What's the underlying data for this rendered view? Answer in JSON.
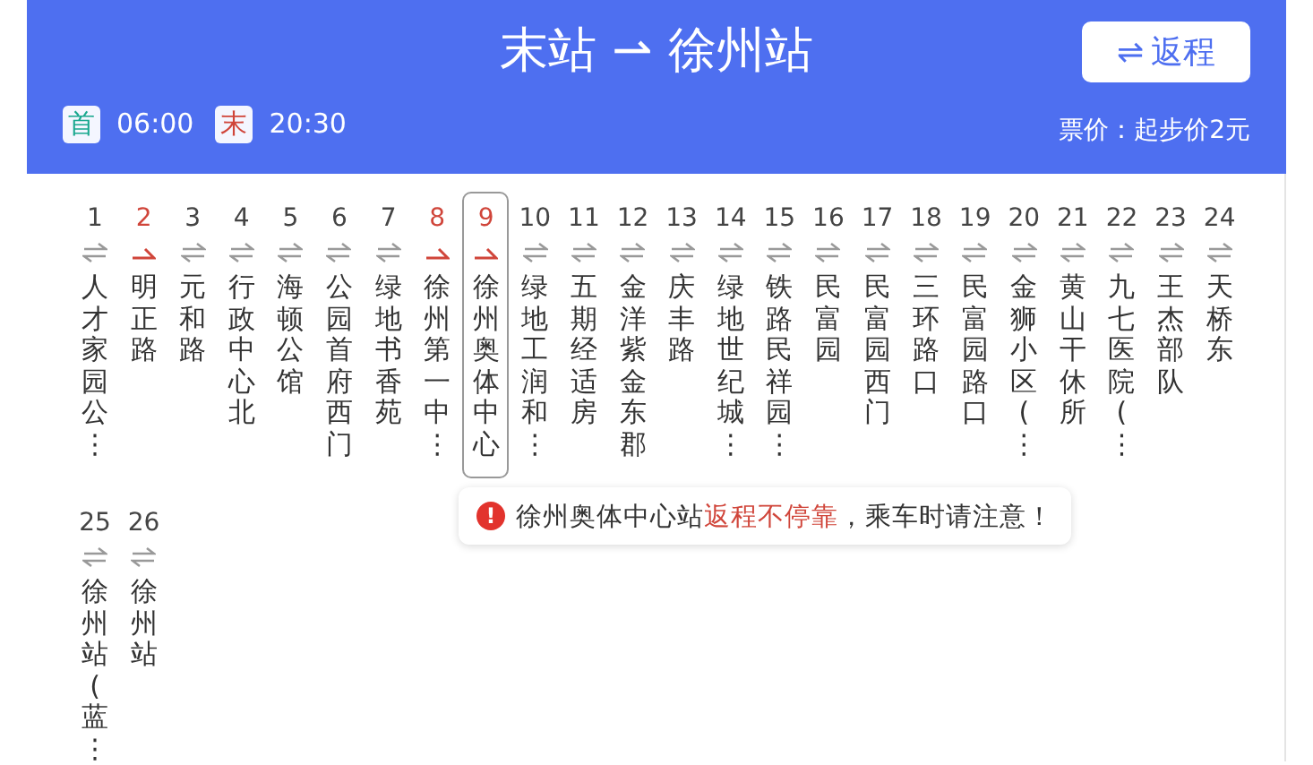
{
  "header": {
    "title": "末站 ⇀ 徐州站",
    "return_button": {
      "icon": "⇌",
      "label": "返程"
    },
    "first_bus": {
      "badge": "首",
      "time": "06:00"
    },
    "last_bus": {
      "badge": "末",
      "time": "20:30"
    },
    "fare": "票价：起步价2元"
  },
  "stops": [
    {
      "number": "1",
      "name": "人才家园公⋮",
      "kind": "both",
      "selected": false
    },
    {
      "number": "2",
      "name": "明正路",
      "kind": "one-way",
      "selected": false
    },
    {
      "number": "3",
      "name": "元和路",
      "kind": "both",
      "selected": false
    },
    {
      "number": "4",
      "name": "行政中心北",
      "kind": "both",
      "selected": false
    },
    {
      "number": "5",
      "name": "海顿公馆",
      "kind": "both",
      "selected": false
    },
    {
      "number": "6",
      "name": "公园首府西门",
      "kind": "both",
      "selected": false
    },
    {
      "number": "7",
      "name": "绿地书香苑",
      "kind": "both",
      "selected": false
    },
    {
      "number": "8",
      "name": "徐州第一中⋮",
      "kind": "one-way",
      "selected": false
    },
    {
      "number": "9",
      "name": "徐州奥体中心",
      "kind": "one-way",
      "selected": true
    },
    {
      "number": "10",
      "name": "绿地工润和⋮",
      "kind": "both",
      "selected": false
    },
    {
      "number": "11",
      "name": "五期经适房",
      "kind": "both",
      "selected": false
    },
    {
      "number": "12",
      "name": "金洋紫金东郡",
      "kind": "both",
      "selected": false
    },
    {
      "number": "13",
      "name": "庆丰路",
      "kind": "both",
      "selected": false
    },
    {
      "number": "14",
      "name": "绿地世纪城⋮",
      "kind": "both",
      "selected": false
    },
    {
      "number": "15",
      "name": "铁路民祥园⋮",
      "kind": "both",
      "selected": false
    },
    {
      "number": "16",
      "name": "民富园",
      "kind": "both",
      "selected": false
    },
    {
      "number": "17",
      "name": "民富园西门",
      "kind": "both",
      "selected": false
    },
    {
      "number": "18",
      "name": "三环路口",
      "kind": "both",
      "selected": false
    },
    {
      "number": "19",
      "name": "民富园路口",
      "kind": "both",
      "selected": false
    },
    {
      "number": "20",
      "name": "金狮小区(⋮",
      "kind": "both",
      "selected": false
    },
    {
      "number": "21",
      "name": "黄山干休所",
      "kind": "both",
      "selected": false
    },
    {
      "number": "22",
      "name": "九七医院(⋮",
      "kind": "both",
      "selected": false
    },
    {
      "number": "23",
      "name": "王杰部队",
      "kind": "both",
      "selected": false
    },
    {
      "number": "24",
      "name": "天桥东",
      "kind": "both",
      "selected": false
    },
    {
      "number": "25",
      "name": "徐州站(蓝⋮",
      "kind": "both",
      "selected": false
    },
    {
      "number": "26",
      "name": "徐州站",
      "kind": "both",
      "selected": false
    }
  ],
  "notice": {
    "icon": "!",
    "parts": [
      {
        "text": "徐州奥体中心站",
        "highlight": false
      },
      {
        "text": "返程不停靠",
        "highlight": true
      },
      {
        "text": "，乘车时请注意！",
        "highlight": false
      }
    ]
  }
}
